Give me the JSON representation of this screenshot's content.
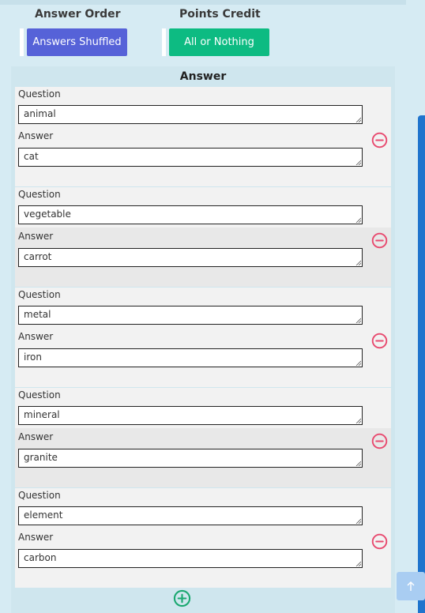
{
  "settings": {
    "answer_order": {
      "label": "Answer Order",
      "value": "Answers Shuffled",
      "color": "#5662d8"
    },
    "points_credit": {
      "label": "Points Credit",
      "value": "All or Nothing",
      "color": "#0dbb82"
    }
  },
  "answer_panel": {
    "title": "Answer",
    "question_label": "Question",
    "answer_label": "Answer",
    "pairs": [
      {
        "question": "animal",
        "answer": "cat"
      },
      {
        "question": "vegetable",
        "answer": "carrot"
      },
      {
        "question": "metal",
        "answer": "iron"
      },
      {
        "question": "mineral",
        "answer": "granite"
      },
      {
        "question": "element",
        "answer": "carbon"
      }
    ],
    "remove_icon": "minus-circle-icon",
    "add_icon": "plus-circle-icon",
    "remove_color": "#e84a6f",
    "add_color": "#1aa870"
  },
  "back_to_top_icon": "arrow-up-icon"
}
